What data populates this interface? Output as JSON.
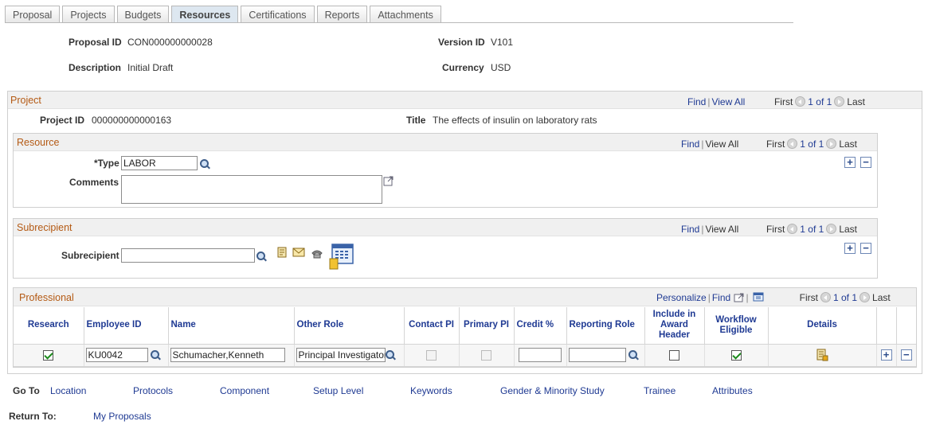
{
  "tabs": [
    "Proposal",
    "Projects",
    "Budgets",
    "Resources",
    "Certifications",
    "Reports",
    "Attachments"
  ],
  "header": {
    "proposal_id_label": "Proposal ID",
    "proposal_id": "CON000000000028",
    "version_id_label": "Version ID",
    "version_id": "V101",
    "description_label": "Description",
    "description": "Initial Draft",
    "currency_label": "Currency",
    "currency": "USD"
  },
  "project": {
    "title": "Project",
    "nav": {
      "find": "Find",
      "view_all": "View All",
      "first": "First",
      "count": "1 of 1",
      "last": "Last"
    },
    "project_id_label": "Project ID",
    "project_id": "000000000000163",
    "title_label": "Title",
    "title_value": "The effects of insulin on laboratory rats"
  },
  "resource": {
    "title": "Resource",
    "nav": {
      "find": "Find",
      "view_all": "View All",
      "first": "First",
      "count": "1 of 1",
      "last": "Last"
    },
    "type_label": "*Type",
    "type_value": "LABOR",
    "comments_label": "Comments",
    "comments_value": ""
  },
  "subrecipient": {
    "title": "Subrecipient",
    "nav": {
      "find": "Find",
      "view_all": "View All",
      "first": "First",
      "count": "1 of 1",
      "last": "Last"
    },
    "label": "Subrecipient",
    "value": ""
  },
  "professional": {
    "title": "Professional",
    "nav": {
      "personalize": "Personalize",
      "find": "Find",
      "first": "First",
      "count": "1 of 1",
      "last": "Last"
    },
    "columns": [
      "Research",
      "Employee ID",
      "Name",
      "Other Role",
      "Contact PI",
      "Primary PI",
      "Credit %",
      "Reporting Role",
      "Include in Award Header",
      "Workflow Eligible",
      "Details"
    ],
    "rows": [
      {
        "research": true,
        "employee_id": "KU0042",
        "name": "Schumacher,Kenneth",
        "other_role": "Principal Investigator",
        "contact_pi": false,
        "primary_pi": false,
        "credit": "",
        "reporting_role": "",
        "include_award_header": false,
        "workflow_eligible": true
      }
    ]
  },
  "goto": {
    "label": "Go To",
    "links": [
      "Location",
      "Protocols",
      "Component",
      "Setup Level",
      "Keywords",
      "Gender & Minority Study",
      "Trainee",
      "Attributes"
    ]
  },
  "return_to": {
    "label": "Return To:",
    "link": "My Proposals"
  },
  "colors": {
    "section_title": "#b45a14",
    "link": "#1f3a93",
    "header_bg": "#f0f0f0"
  }
}
